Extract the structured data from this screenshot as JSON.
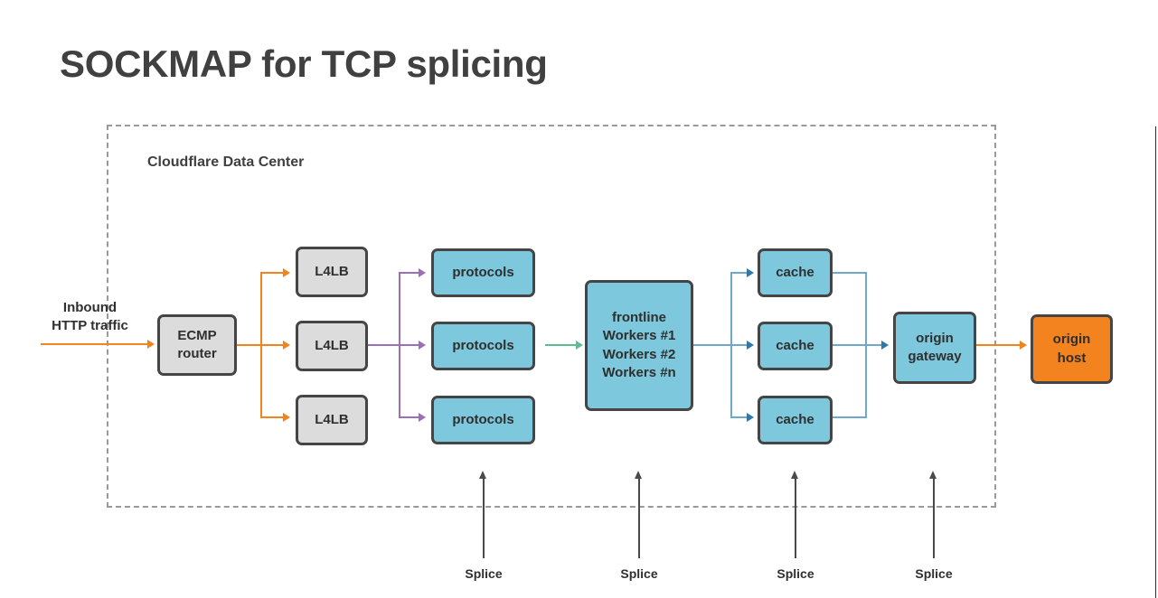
{
  "slide": {
    "title": "SOCKMAP for TCP splicing",
    "boundary_label": "Cloudflare Data Center"
  },
  "labels": {
    "inbound": "Inbound\nHTTP traffic",
    "inbound_line1": "Inbound",
    "inbound_line2": "HTTP traffic"
  },
  "nodes": {
    "ecmp": {
      "line1": "ECMP",
      "line2": "router"
    },
    "l4lb": [
      "L4LB",
      "L4LB",
      "L4LB"
    ],
    "protocols": [
      "protocols",
      "protocols",
      "protocols"
    ],
    "frontline": {
      "line1": "frontline",
      "line2": "Workers #1",
      "line3": "Workers #2",
      "line4": "Workers #n"
    },
    "cache": [
      "cache",
      "cache",
      "cache"
    ],
    "origin_gateway": {
      "line1": "origin",
      "line2": "gateway"
    },
    "origin_host": {
      "line1": "origin",
      "line2": "host"
    }
  },
  "splices": [
    {
      "label": "Splice"
    },
    {
      "label": "Splice"
    },
    {
      "label": "Splice"
    },
    {
      "label": "Splice"
    }
  ],
  "colors": {
    "title": "#404040",
    "box_gray": "#dcdcdc",
    "box_blue": "#7dc8dc",
    "box_orange": "#f2831e",
    "box_border": "#454545",
    "arrow_orange": "#f2831e",
    "arrow_purple": "#9b70b5",
    "arrow_green": "#5cbd92",
    "arrow_blue": "#2f78a8",
    "arrow_blue_light": "#6fa8c9",
    "boundary_dash": "#9a9a9a",
    "splice_arrow": "#4a4a4a"
  }
}
